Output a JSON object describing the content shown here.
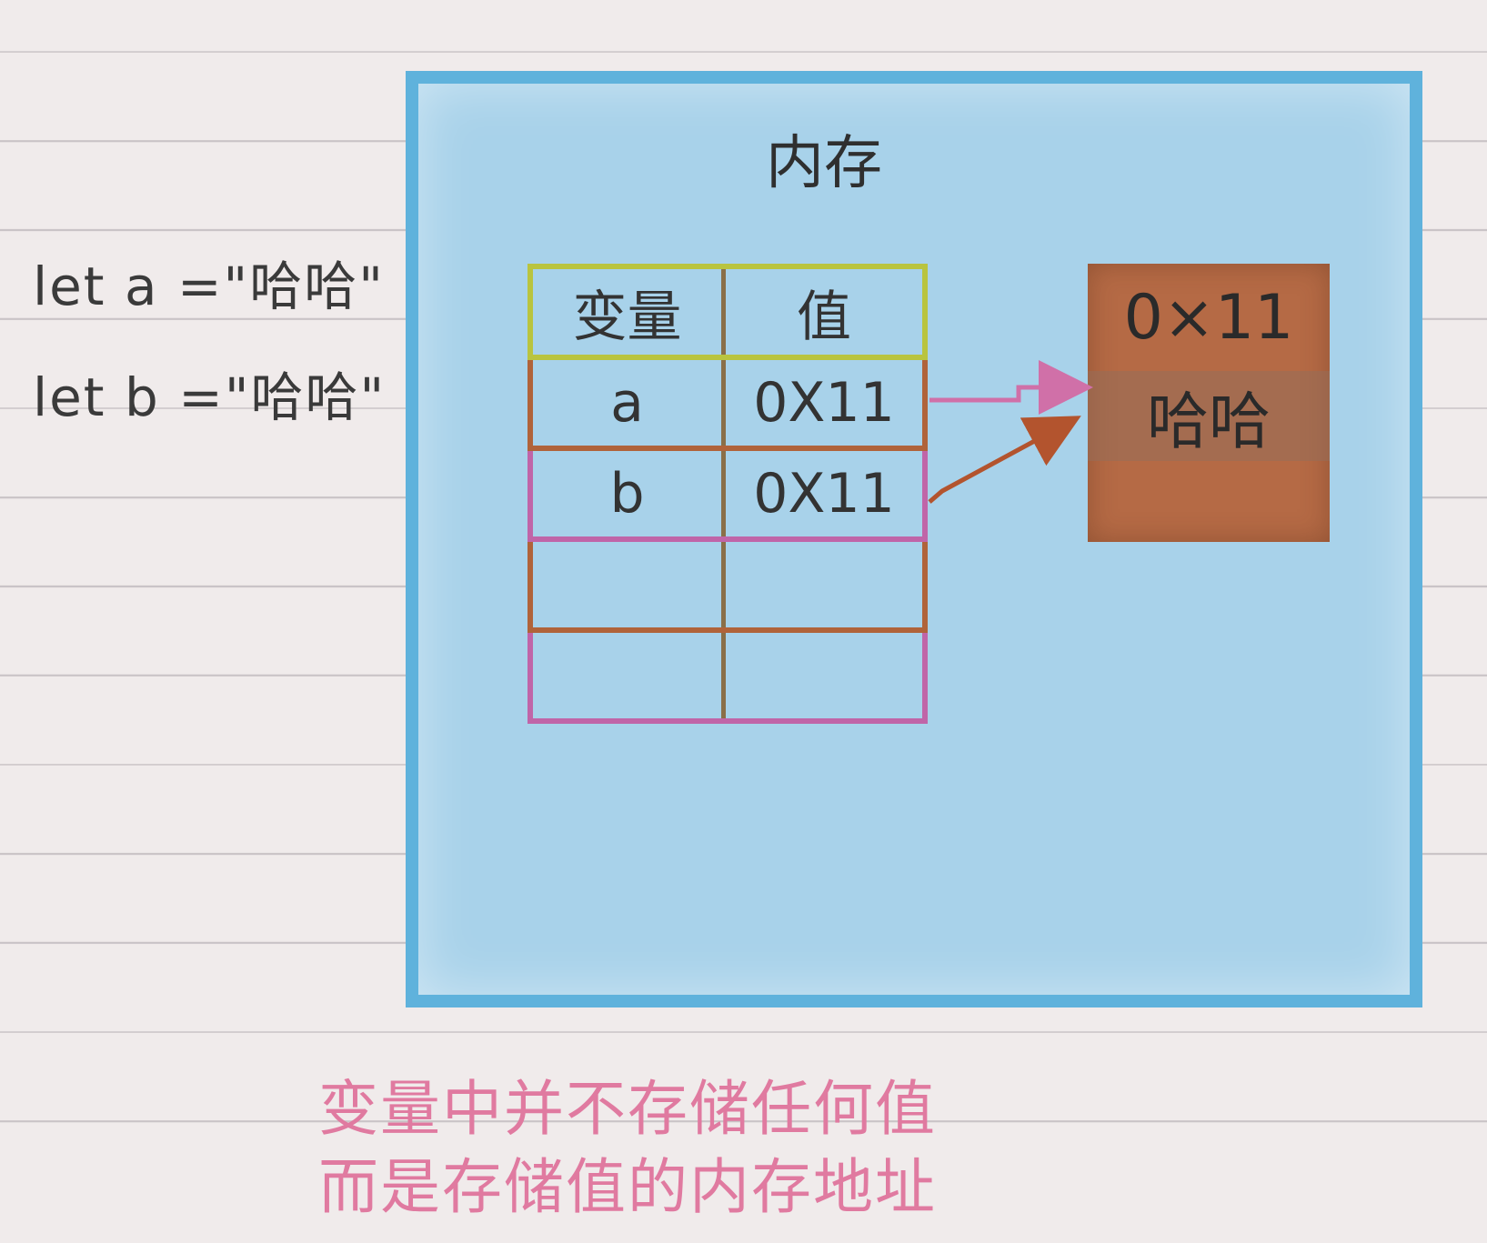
{
  "code": {
    "line1": "let a =\"哈哈\"",
    "line2": "let b =\"哈哈\""
  },
  "memory": {
    "title": "内存",
    "table": {
      "headers": [
        "变量",
        "值"
      ],
      "rows": [
        {
          "variable": "a",
          "value": "0X11"
        },
        {
          "variable": "b",
          "value": "0X11"
        },
        {
          "variable": "",
          "value": ""
        },
        {
          "variable": "",
          "value": ""
        }
      ]
    },
    "heap": {
      "address": "0×11",
      "value": "哈哈"
    }
  },
  "note": {
    "line1": "变量中并不存储任何值",
    "line2": "而是存储值的内存地址"
  },
  "colors": {
    "memory_fill": "#a8d2ea",
    "memory_border": "#5fb2dc",
    "heap_fill": "#b56a45",
    "note_text": "#e07aa0",
    "arrow_a": "#d070a8",
    "arrow_b": "#b3542e"
  }
}
